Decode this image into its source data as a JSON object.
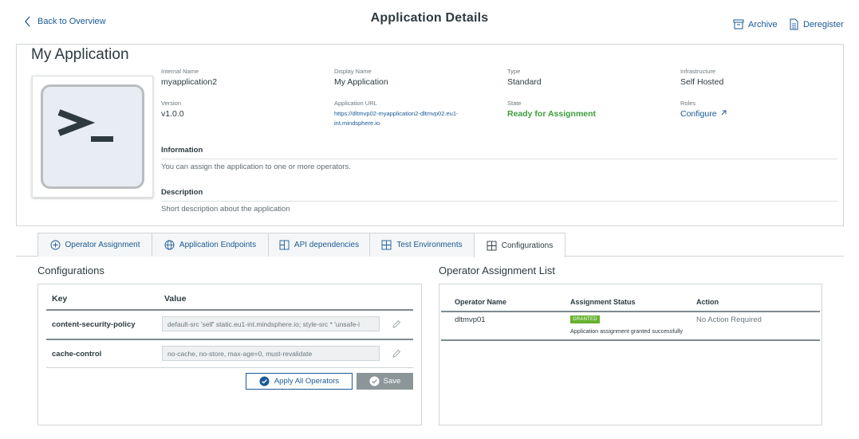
{
  "header": {
    "back_label": "Back to Overview",
    "title": "Application Details",
    "archive_label": "Archive",
    "deregister_label": "Deregister"
  },
  "app": {
    "name": "My Application",
    "logo_icon": "terminal-prompt-icon",
    "fields": {
      "internal_name": {
        "label": "Internal Name",
        "value": "myapplication2"
      },
      "display_name": {
        "label": "Display Name",
        "value": "My Application"
      },
      "type": {
        "label": "Type",
        "value": "Standard"
      },
      "infrastructure": {
        "label": "Infrastructure",
        "value": "Self Hosted"
      },
      "version": {
        "label": "Version",
        "value": "v1.0.0"
      },
      "application_url": {
        "label": "Application URL",
        "value": "https://dltmvp02-myapplication2-dltmvp02.eu1-int.mindsphere.io"
      },
      "state": {
        "label": "State",
        "value": "Ready for Assignment"
      },
      "roles": {
        "label": "Roles",
        "value": "Configure"
      }
    },
    "information": {
      "heading": "Information",
      "text": "You can assign the application to one or more operators."
    },
    "description": {
      "heading": "Description",
      "text": "Short description about the application"
    }
  },
  "tabs": [
    {
      "label": "Operator Assignment",
      "icon": "plus-circle-icon"
    },
    {
      "label": "Application Endpoints",
      "icon": "globe-icon"
    },
    {
      "label": "API dependencies",
      "icon": "grid-icon"
    },
    {
      "label": "Test Environments",
      "icon": "grid-icon"
    },
    {
      "label": "Configurations",
      "icon": "grid-icon",
      "active": true
    }
  ],
  "configurations": {
    "title": "Configurations",
    "key_header": "Key",
    "value_header": "Value",
    "rows": [
      {
        "key": "content-security-policy",
        "value": "default-src 'self' static.eu1-int.mindsphere.io; style-src * 'unsafe-i"
      },
      {
        "key": "cache-control",
        "value": "no-cache, no-store, max-age=0, must-revalidate"
      }
    ],
    "apply_label": "Apply All Operators",
    "save_label": "Save"
  },
  "operator_list": {
    "title": "Operator Assignment List",
    "headers": [
      "Operator Name",
      "Assignment Status",
      "Action"
    ],
    "rows": [
      {
        "operator": "dltmvp01",
        "status_badge": "GRANTED",
        "status_text": "Application assignment granted successfully",
        "action": "No Action Required"
      }
    ]
  },
  "colors": {
    "link": "#1a5a96",
    "ready": "#3c9c3c",
    "granted": "#65b32e",
    "save_disabled": "#8c9699"
  }
}
